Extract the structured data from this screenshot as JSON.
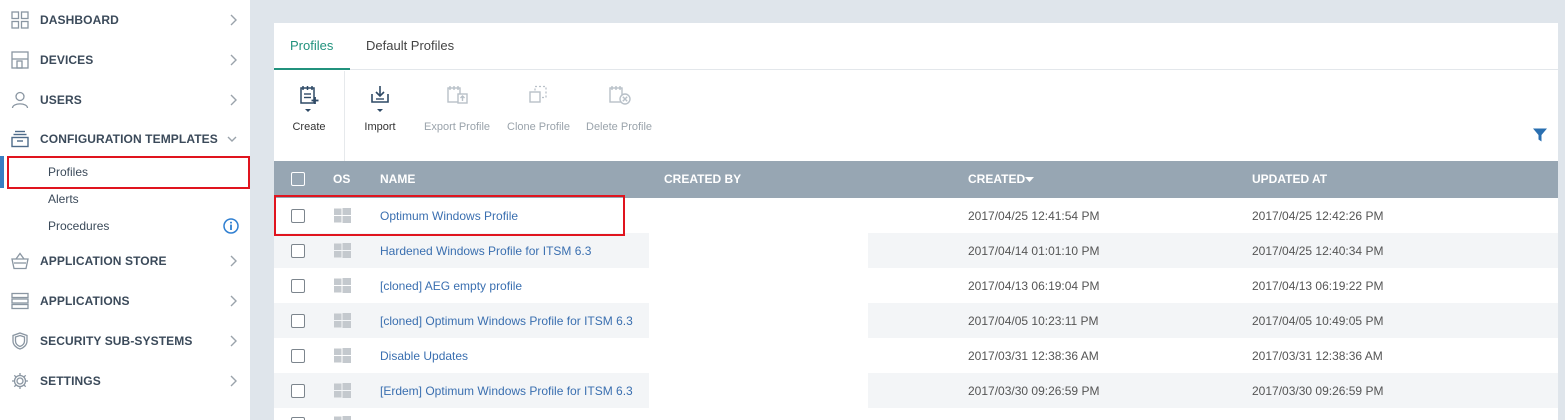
{
  "sidebar": {
    "items": [
      {
        "label": "DASHBOARD",
        "icon": "dashboard-icon"
      },
      {
        "label": "DEVICES",
        "icon": "devices-icon"
      },
      {
        "label": "USERS",
        "icon": "user-icon"
      },
      {
        "label": "CONFIGURATION TEMPLATES",
        "icon": "configuration-templates-icon",
        "expanded": true
      },
      {
        "label": "APPLICATION STORE",
        "icon": "basket-icon"
      },
      {
        "label": "APPLICATIONS",
        "icon": "applications-icon"
      },
      {
        "label": "SECURITY SUB-SYSTEMS",
        "icon": "shield-icon"
      },
      {
        "label": "SETTINGS",
        "icon": "gear-icon"
      }
    ],
    "subitems": [
      {
        "label": "Profiles",
        "active": true
      },
      {
        "label": "Alerts"
      },
      {
        "label": "Procedures",
        "icon": "info-icon"
      }
    ]
  },
  "tabs": [
    {
      "label": "Profiles",
      "active": true
    },
    {
      "label": "Default Profiles"
    }
  ],
  "toolbar": {
    "create_label": "Create",
    "import_label": "Import",
    "export_label": "Export Profile",
    "clone_label": "Clone Profile",
    "delete_label": "Delete Profile"
  },
  "table": {
    "headers": {
      "os": "OS",
      "name": "NAME",
      "created_by": "CREATED BY",
      "created": "CREATED",
      "updated_at": "UPDATED AT"
    },
    "sort_column": "created",
    "sort_direction": "desc",
    "rows": [
      {
        "os": "windows-icon",
        "name": "Optimum Windows Profile",
        "created_by": "",
        "created": "2017/04/25 12:41:54 PM",
        "updated_at": "2017/04/25 12:42:26 PM"
      },
      {
        "os": "windows-icon",
        "name": "Hardened Windows Profile for ITSM 6.3",
        "created_by": "",
        "created": "2017/04/14 01:01:10 PM",
        "updated_at": "2017/04/25 12:40:34 PM"
      },
      {
        "os": "windows-icon",
        "name": "[cloned] AEG empty profile",
        "created_by": "",
        "created": "2017/04/13 06:19:04 PM",
        "updated_at": "2017/04/13 06:19:22 PM"
      },
      {
        "os": "windows-icon",
        "name": "[cloned] Optimum Windows Profile for ITSM 6.3",
        "created_by": "",
        "created": "2017/04/05 10:23:11 PM",
        "updated_at": "2017/04/05 10:49:05 PM"
      },
      {
        "os": "windows-icon",
        "name": "Disable Updates",
        "created_by": "",
        "created": "2017/03/31 12:38:36 AM",
        "updated_at": "2017/03/31 12:38:36 AM"
      },
      {
        "os": "windows-icon",
        "name": "[Erdem] Optimum Windows Profile for ITSM 6.3",
        "created_by": "",
        "created": "2017/03/30 09:26:59 PM",
        "updated_at": "2017/03/30 09:26:59 PM"
      }
    ]
  },
  "colors": {
    "accent": "#21927d",
    "link": "#3a6fb0",
    "highlight": "#e0141e",
    "header_bg": "#97a6b3"
  }
}
